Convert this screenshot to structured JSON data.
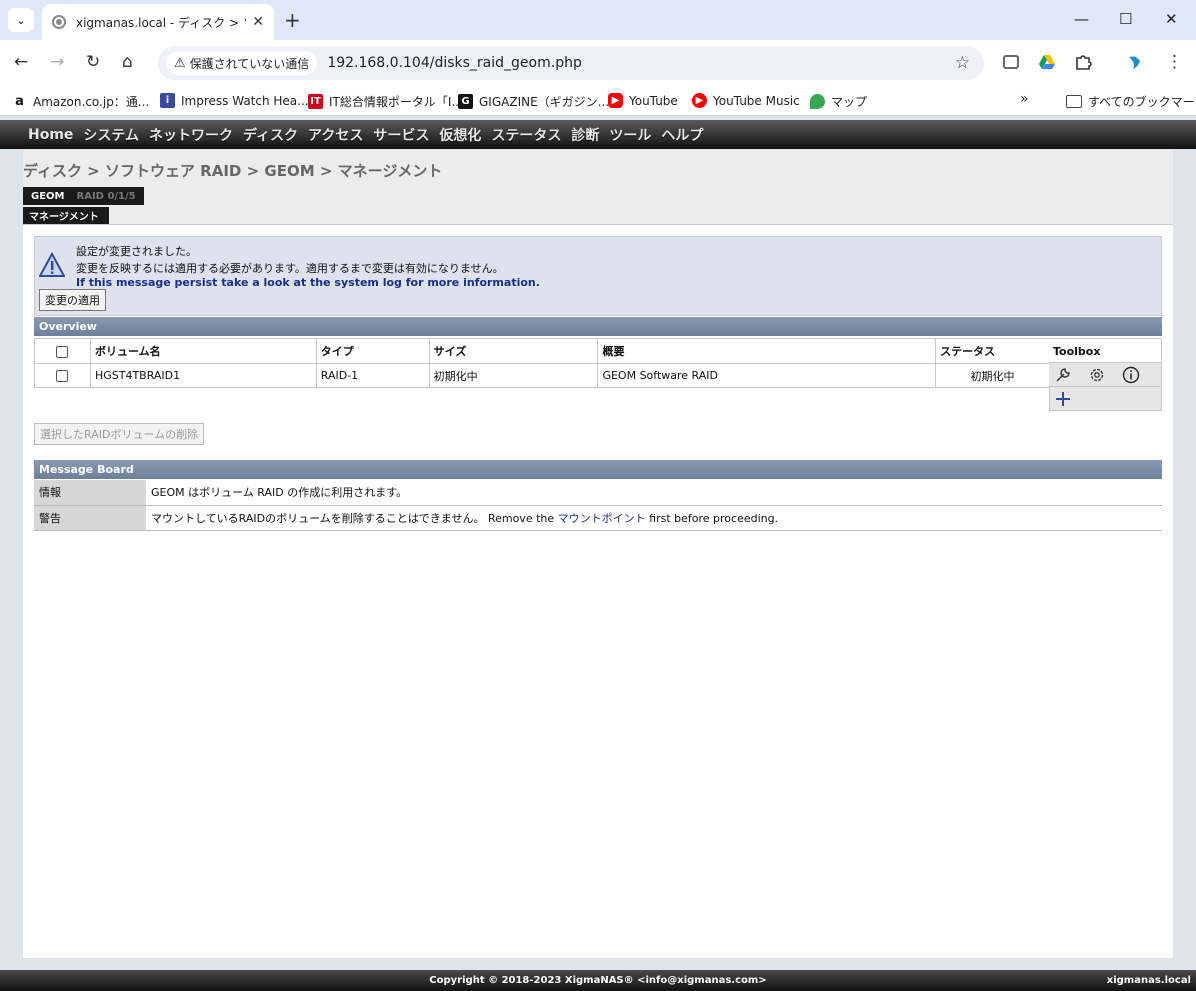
{
  "browser": {
    "tab_title": "xigmanas.local - ディスク > ソフトウ",
    "security_label": "保護されていない通信",
    "url": "192.168.0.104/disks_raid_geom.php",
    "bookmarks": [
      {
        "label": "Amazon.co.jp：通..."
      },
      {
        "label": "Impress Watch Hea..."
      },
      {
        "label": "IT総合情報ポータル「I..."
      },
      {
        "label": "GIGAZINE（ギガジン..."
      },
      {
        "label": "YouTube"
      },
      {
        "label": "YouTube Music"
      },
      {
        "label": "マップ"
      }
    ],
    "all_bookmarks": "すべてのブックマーク"
  },
  "menu": [
    "Home",
    "システム",
    "ネットワーク",
    "ディスク",
    "アクセス",
    "サービス",
    "仮想化",
    "ステータス",
    "診断",
    "ツール",
    "ヘルプ"
  ],
  "breadcrumb": "ディスク > ソフトウェア RAID > GEOM > マネージメント",
  "tabs": {
    "active": "GEOM",
    "inactive": "RAID 0/1/5",
    "sub": "マネージメント"
  },
  "alert": {
    "line1": "設定が変更されました。",
    "line2": "変更を反映するには適用する必要があります。適用するまで変更は有効になりません。",
    "line3": "If this message persist take a look at the system log for more information.",
    "apply_button": "変更の適用"
  },
  "overview": {
    "title": "Overview",
    "columns": [
      "ボリューム名",
      "タイプ",
      "サイズ",
      "概要",
      "ステータス"
    ],
    "toolbox_header": "Toolbox",
    "rows": [
      {
        "name": "HGST4TBRAID1",
        "type": "RAID-1",
        "size": "初期化中",
        "desc": "GEOM Software RAID",
        "status": "初期化中"
      }
    ]
  },
  "delete_button": "選択したRAIDボリュームの削除",
  "message_board": {
    "title": "Message Board",
    "info_key": "情報",
    "info_value": "GEOM はボリューム RAID の作成に利用されます。",
    "warn_key": "警告",
    "warn_text1": "マウントしているRAIDのボリュームを削除することはできません。 Remove the ",
    "warn_link": "マウントポイント",
    "warn_text2": " first before proceeding."
  },
  "footer": {
    "copyright": "Copyright © 2018-2023 XigmaNAS® <info@xigmanas.com>",
    "host": "xigmanas.local"
  }
}
